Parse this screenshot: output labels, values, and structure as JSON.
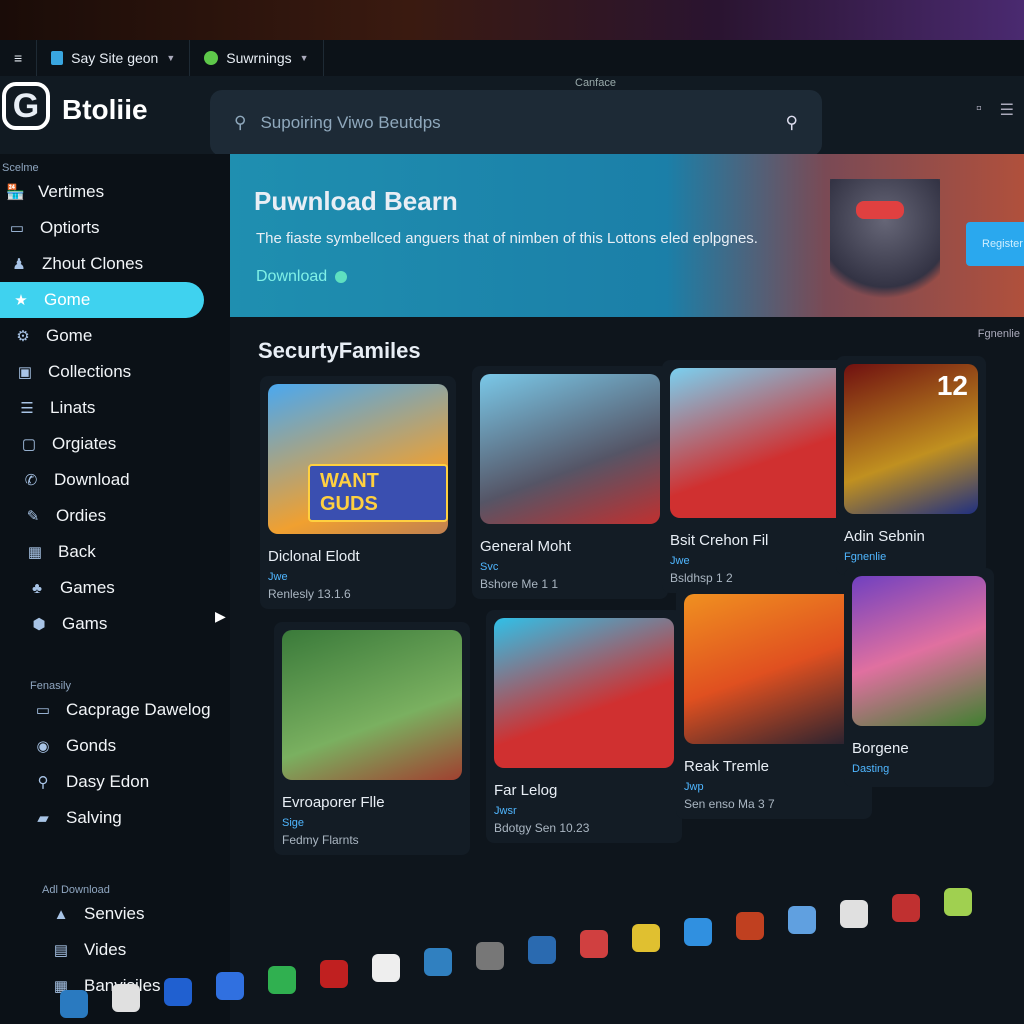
{
  "tabs": [
    {
      "label": "Say Site geon"
    },
    {
      "label": "Suwrnings"
    }
  ],
  "window_title": "Canface",
  "brand": {
    "logo": "G",
    "name": "Btoliie"
  },
  "search": {
    "placeholder": "Supoiring Viwo Beutdps"
  },
  "sidebar": {
    "section1": "Scelme",
    "items": [
      {
        "label": "Vertimes",
        "icon": "store-icon"
      },
      {
        "label": "Optiorts",
        "icon": "card-icon"
      },
      {
        "label": "Zhout Clones",
        "icon": "gamepad-icon"
      },
      {
        "label": "Gome",
        "icon": "star-icon",
        "active": true
      },
      {
        "label": "Gome",
        "icon": "gear-icon"
      },
      {
        "label": "Collections",
        "icon": "collection-icon"
      },
      {
        "label": "Linats",
        "icon": "list-icon"
      },
      {
        "label": "Orgiates",
        "icon": "chat-icon"
      },
      {
        "label": "Download",
        "icon": "phone-icon"
      },
      {
        "label": "Ordies",
        "icon": "pen-icon"
      },
      {
        "label": "Back",
        "icon": "grid-icon"
      },
      {
        "label": "Games",
        "icon": "controller-icon"
      },
      {
        "label": "Gams",
        "icon": "hexagon-icon"
      }
    ],
    "section2": "Fenasily",
    "items2": [
      {
        "label": "Cacprage Dawelog",
        "icon": "monitor-icon"
      },
      {
        "label": "Gonds",
        "icon": "shield-icon"
      },
      {
        "label": "Dasy Edon",
        "icon": "pin-icon"
      },
      {
        "label": "Salving",
        "icon": "camera-icon"
      }
    ],
    "section3": "Adl Download",
    "items3": [
      {
        "label": "Senvies",
        "icon": "triangle-icon"
      },
      {
        "label": "Vides",
        "icon": "video-icon"
      },
      {
        "label": "Banvisiles",
        "icon": "calendar-icon"
      }
    ]
  },
  "banner": {
    "title": "Puwnload Bearn",
    "description": "The fiaste symbellced anguers that of nimben of this Lottons eled eplpgnes.",
    "link": "Download",
    "button": "Register"
  },
  "section_title": "SecurtyFamiles",
  "section_more": "Fgnenlie",
  "cards": [
    {
      "title": "Diclonal Elodt",
      "tag": "Jwe",
      "meta": "Renlesly 13.1.6",
      "art_text": "WANT GUDS"
    },
    {
      "title": "General Moht",
      "tag": "Svc",
      "meta": "Bshore Me 1 1"
    },
    {
      "title": "Bsit Crehon Fil",
      "tag": "Jwe",
      "meta": "Bsldhsp 1 2"
    },
    {
      "title": "Adin Sebnin",
      "tag": "Fgnenlie",
      "meta": "",
      "badge": "12"
    },
    {
      "title": "Evroaporer Flle",
      "tag": "Sige",
      "meta": "Fedmy Flarnts"
    },
    {
      "title": "Far Lelog",
      "tag": "Jwsr",
      "meta": "Bdotgy Sen 10.23"
    },
    {
      "title": "Reak Tremle",
      "tag": "Jwp",
      "meta": "Sen enso Ma 3 7"
    },
    {
      "title": "Borgene",
      "tag": "Dasting",
      "meta": ""
    }
  ]
}
